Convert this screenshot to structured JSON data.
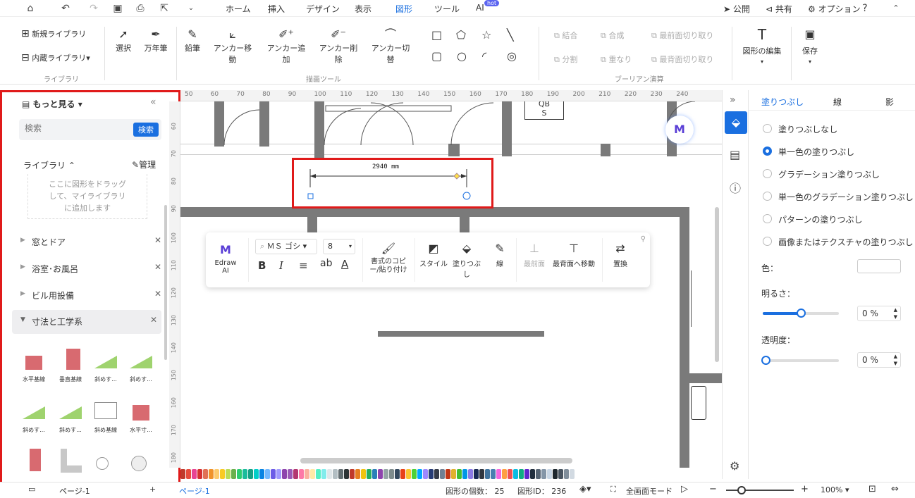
{
  "topbar": {
    "menus": [
      "ホーム",
      "挿入",
      "デザイン",
      "表示",
      "図形",
      "ツール",
      "AI"
    ],
    "active_menu": "図形",
    "hot_badge": "hot",
    "right": {
      "publish": "公開",
      "share": "共有",
      "options": "オプション"
    }
  },
  "ribbon": {
    "library": {
      "new_library": "新規ライブラリ",
      "builtin_library": "内蔵ライブラリ",
      "group": "ライブラリ"
    },
    "draw_tools": {
      "select": "選択",
      "pen": "万年筆",
      "pencil": "鉛筆",
      "anchor_move": "アンカー移動",
      "anchor_add": "アンカー追加",
      "anchor_delete": "アンカー削除",
      "anchor_switch": "アンカー切替",
      "group": "描画ツール"
    },
    "boolean": {
      "union": "結合",
      "combine": "合成",
      "front_cut": "最前面切り取り",
      "split": "分割",
      "overlap": "重なり",
      "back_cut": "最背面切り取り",
      "group": "ブーリアン演算"
    },
    "edit_shape": "図形の編集",
    "save": "保存"
  },
  "left_panel": {
    "more": "もっと見る",
    "search_placeholder": "検索",
    "search_button": "検索",
    "my_library": "ライブラリ",
    "manage": "管理",
    "drop_hint": "ここに図形をドラッグして、マイライブラリに追加します",
    "categories": [
      "窓とドア",
      "浴室･お風呂",
      "ビル用設備",
      "寸法と工学系"
    ],
    "thumbs": [
      "水平基線",
      "垂直基線",
      "斜めす...",
      "斜めす...",
      "斜めす...",
      "斜めす...",
      "斜め基線",
      "水平寸..."
    ]
  },
  "ruler_top": [
    "50",
    "60",
    "70",
    "80",
    "90",
    "100",
    "110",
    "120",
    "130",
    "140",
    "150",
    "160",
    "170",
    "180",
    "190",
    "200",
    "210",
    "220",
    "230",
    "240"
  ],
  "ruler_left": [
    "60",
    "70",
    "80",
    "90",
    "100",
    "110",
    "120",
    "130",
    "140",
    "150",
    "160",
    "170",
    "180"
  ],
  "canvas": {
    "dimension_text": "2940 mm",
    "room_label_top": "QB",
    "room_label": "S"
  },
  "float_toolbar": {
    "ai": "Edraw AI",
    "font": "ＭＳ ゴシ",
    "size": "8",
    "format_copy": "書式のコピー/貼り付け",
    "style": "スタイル",
    "fill": "塗りつぶし",
    "line": "線",
    "front": "最前面",
    "back": "最背面へ移動",
    "replace": "置換"
  },
  "right_panel": {
    "tabs": [
      "塗りつぶし",
      "線",
      "影"
    ],
    "options": [
      "塗りつぶしなし",
      "単一色の塗りつぶし",
      "グラデーション塗りつぶし",
      "単一色のグラデーション塗りつぶし",
      "パターンの塗りつぶし",
      "画像またはテクスチャの塗りつぶし"
    ],
    "color_label": "色：",
    "brightness_label": "明るさ：",
    "brightness_value": "0 %",
    "opacity_label": "透明度：",
    "opacity_value": "0 %"
  },
  "status": {
    "page_tab": "ページ-1",
    "page_tab_active": "ページ-1",
    "shape_count": "図形の個数： 25",
    "shape_id": "図形ID： 236",
    "fullscreen": "全画面モード",
    "zoom": "100%"
  },
  "palette": [
    "#c0392b",
    "#e74c3c",
    "#e84393",
    "#d63031",
    "#e17055",
    "#f0932b",
    "#fdcb6e",
    "#f9ca24",
    "#badc58",
    "#6ab04c",
    "#2ecc71",
    "#1abc9c",
    "#16a085",
    "#00cec9",
    "#0984e3",
    "#74b9ff",
    "#6c5ce7",
    "#a29bfe",
    "#8e44ad",
    "#9b59b6",
    "#b33771",
    "#fd79a8",
    "#fab1a0",
    "#ffeaa7",
    "#55efc4",
    "#81ecec",
    "#dfe6e9",
    "#b2bec3",
    "#636e72",
    "#2d3436",
    "#c0392b",
    "#e67e22",
    "#f1c40f",
    "#27ae60",
    "#2980b9",
    "#8e44ad",
    "#95a5a6",
    "#7f8c8d",
    "#34495e",
    "#e84118",
    "#fbc531",
    "#4cd137",
    "#00a8ff",
    "#9c88ff",
    "#273c75",
    "#353b48",
    "#718093",
    "#c23616",
    "#e1b12c",
    "#44bd32",
    "#0097e6",
    "#8c7ae6",
    "#192a56",
    "#2f3640",
    "#40739e",
    "#487eb0",
    "#f368e0",
    "#ff9f43",
    "#ee5253",
    "#0abde3",
    "#10ac84",
    "#5f27cd",
    "#222f3e",
    "#576574",
    "#8395a7",
    "#c8d6e5",
    "#1e272e",
    "#485460",
    "#808e9b",
    "#d2dae2"
  ]
}
